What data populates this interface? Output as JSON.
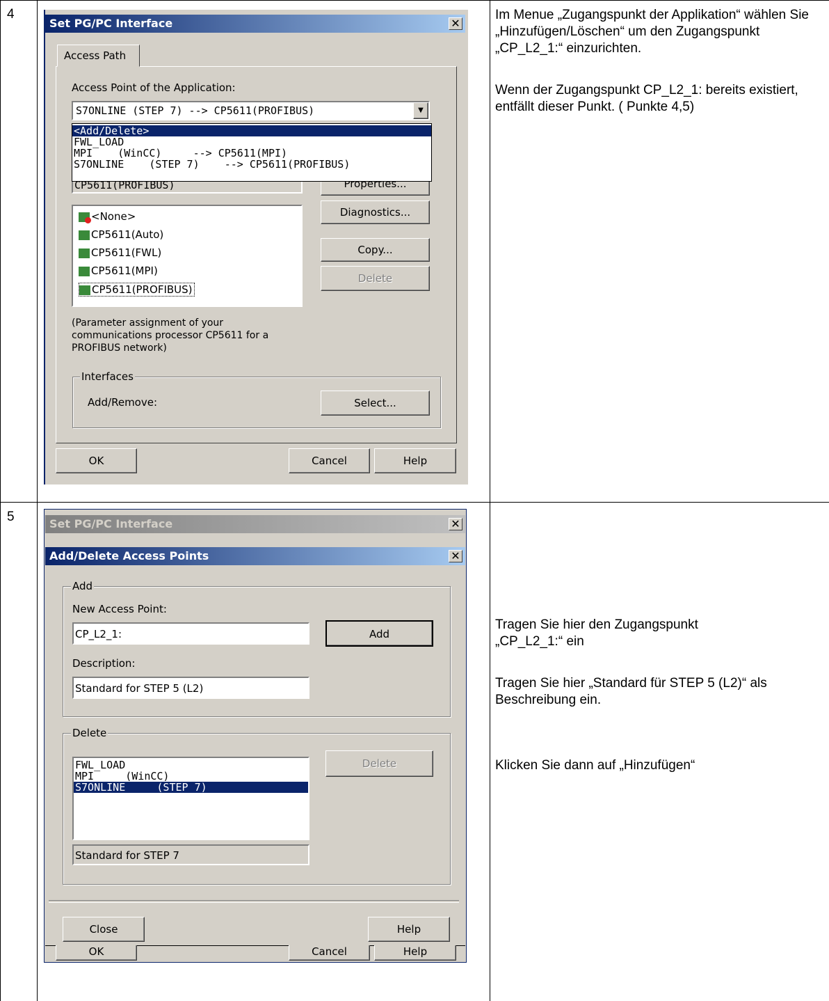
{
  "rows": [
    {
      "step": "4",
      "desc": [
        "Im Menue „Zugangspunkt der Applikation“ wählen Sie „Hinzufügen/Löschen“ um den Zugangspunkt „CP_L2_1:“ einzurichten.",
        "Wenn der Zugangspunkt CP_L2_1: bereits existiert, entfällt dieser Punkt. ( Punkte 4,5)"
      ]
    },
    {
      "step": "5",
      "desc": [
        "Tragen Sie hier den Zugangspunkt „CP_L2_1:“ ein",
        "Tragen Sie hier „Standard für STEP 5 (L2)“ als Beschreibung ein.",
        "Klicken Sie dann auf „Hinzufügen“"
      ]
    }
  ],
  "dialog1": {
    "title": "Set PG/PC Interface",
    "tab": "Access Path",
    "access_point_label": "Access Point of the Application:",
    "combo_value": "S7ONLINE    (STEP 7)    --> CP5611(PROFIBUS)",
    "dropdown": [
      "<Add/Delete>",
      "FWL_LOAD",
      "MPI    (WinCC)     --> CP5611(MPI)",
      "S7ONLINE    (STEP 7)    --> CP5611(PROFIBUS)"
    ],
    "param_value": "CP5611(PROFIBUS)",
    "properties_btn": "Properties...",
    "diagnostics_btn": "Diagnostics...",
    "copy_btn": "Copy...",
    "delete_btn": "Delete",
    "interfaces": [
      "<None>",
      "CP5611(Auto)",
      "CP5611(FWL)",
      "CP5611(MPI)",
      "CP5611(PROFIBUS)"
    ],
    "info_text": [
      "(Parameter assignment of your",
      "communications processor CP5611 for a",
      "PROFIBUS network)"
    ],
    "interfaces_group": "Interfaces",
    "add_remove_label": "Add/Remove:",
    "select_btn": "Select...",
    "ok_btn": "OK",
    "cancel_btn": "Cancel",
    "help_btn": "Help"
  },
  "dialog2": {
    "parent_title": "Set PG/PC Interface",
    "title": "Add/Delete Access Points",
    "add_group": "Add",
    "new_ap_label": "New Access Point:",
    "new_ap_value": "CP_L2_1:",
    "add_btn": "Add",
    "desc_label": "Description:",
    "desc_value": "Standard for STEP 5 (L2)",
    "delete_group": "Delete",
    "delete_list": [
      "FWL_LOAD",
      "MPI     (WinCC)",
      "S7ONLINE     (STEP 7)"
    ],
    "delete_btn": "Delete",
    "delete_desc": "Standard for STEP 7",
    "close_btn": "Close",
    "help_btn": "Help",
    "ok_btn": "OK",
    "cancel_btn": "Cancel",
    "help_btn2": "Help"
  }
}
